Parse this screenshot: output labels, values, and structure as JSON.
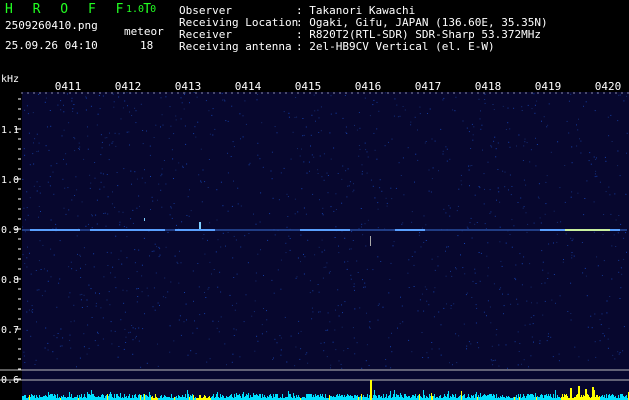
{
  "app": {
    "title": "H R O F F T",
    "version": "1.0.0"
  },
  "file": {
    "name": "2509260410.png",
    "datetime": "25.09.26 04:10"
  },
  "detection": {
    "label": "meteor",
    "count": "18"
  },
  "info": {
    "keys": [
      "Observer",
      "Receiving Location",
      "Receiver",
      "Receiving antenna"
    ],
    "values": [
      ": Takanori Kawachi",
      ": Ogaki, Gifu, JAPAN (136.60E, 35.35N)",
      ": R820T2(RTL-SDR) SDR-Sharp 53.372MHz",
      ": 2el-HB9CV Vertical (el. E-W)"
    ]
  },
  "axis": {
    "unit": "kHz",
    "y_ticks": [
      "1.1",
      "1.0",
      "0.9",
      "0.8",
      "0.7",
      "0.6"
    ],
    "time_labels": [
      "0411",
      "0412",
      "0413",
      "0414",
      "0415",
      "0416",
      "0417",
      "0418",
      "0419",
      "0420"
    ]
  },
  "colors": {
    "green": "#22ff22",
    "background": "#000000",
    "spectrogram_base": "#0a0a3a",
    "signal": "#5aa0ff",
    "power_cyan": "#00e0ff",
    "power_yellow": "#ffff00"
  }
}
